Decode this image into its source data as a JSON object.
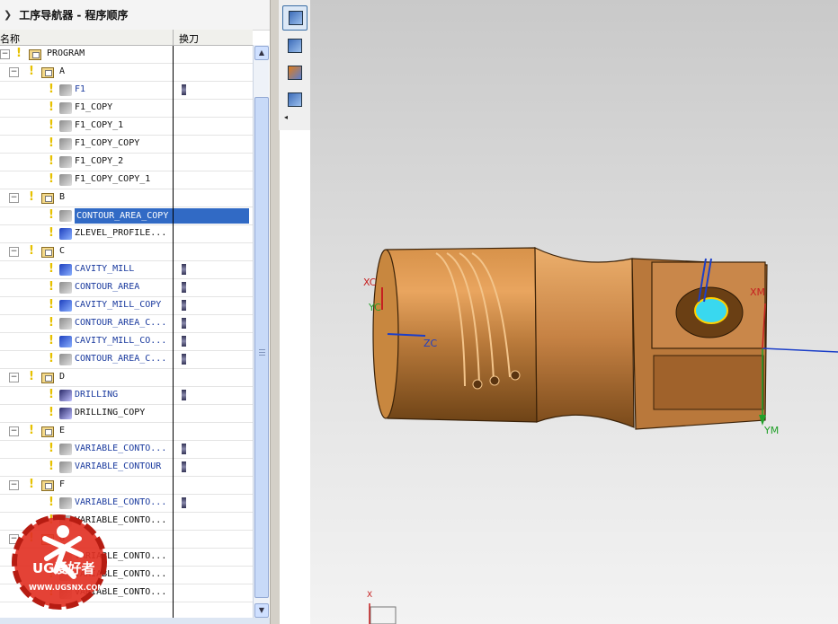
{
  "navigator": {
    "title": "工序导航器 - 程序顺序",
    "columns": {
      "name": "名称",
      "tool_change": "换刀"
    },
    "rows": [
      {
        "label": "PROGRAM",
        "level": 0,
        "kind": "root",
        "color": "black",
        "toggle": "−"
      },
      {
        "label": "A",
        "level": 1,
        "kind": "group",
        "color": "black",
        "toggle": "−"
      },
      {
        "label": "F1",
        "level": 2,
        "kind": "op",
        "color": "blue",
        "tool": true
      },
      {
        "label": "F1_COPY",
        "level": 2,
        "kind": "op",
        "color": "black"
      },
      {
        "label": "F1_COPY_1",
        "level": 2,
        "kind": "op",
        "color": "black"
      },
      {
        "label": "F1_COPY_COPY",
        "level": 2,
        "kind": "op",
        "color": "black"
      },
      {
        "label": "F1_COPY_2",
        "level": 2,
        "kind": "op",
        "color": "black"
      },
      {
        "label": "F1_COPY_COPY_1",
        "level": 2,
        "kind": "op",
        "color": "black"
      },
      {
        "label": "B",
        "level": 1,
        "kind": "group",
        "color": "black",
        "toggle": "−"
      },
      {
        "label": "CONTOUR_AREA_COPY",
        "level": 2,
        "kind": "op",
        "color": "blue",
        "selected": true
      },
      {
        "label": "ZLEVEL_PROFILE...",
        "level": 2,
        "kind": "op-blue",
        "color": "black"
      },
      {
        "label": "C",
        "level": 1,
        "kind": "group",
        "color": "black",
        "toggle": "−"
      },
      {
        "label": "CAVITY_MILL",
        "level": 2,
        "kind": "op-blue",
        "color": "blue",
        "tool": true
      },
      {
        "label": "CONTOUR_AREA",
        "level": 2,
        "kind": "op",
        "color": "blue",
        "tool": true
      },
      {
        "label": "CAVITY_MILL_COPY",
        "level": 2,
        "kind": "op-blue",
        "color": "blue",
        "tool": true
      },
      {
        "label": "CONTOUR_AREA_C...",
        "level": 2,
        "kind": "op",
        "color": "blue",
        "tool": true
      },
      {
        "label": "CAVITY_MILL_CO...",
        "level": 2,
        "kind": "op-blue",
        "color": "blue",
        "tool": true
      },
      {
        "label": "CONTOUR_AREA_C...",
        "level": 2,
        "kind": "op",
        "color": "blue",
        "tool": true
      },
      {
        "label": "D",
        "level": 1,
        "kind": "group",
        "color": "black",
        "toggle": "−"
      },
      {
        "label": "DRILLING",
        "level": 2,
        "kind": "op-drill",
        "color": "blue",
        "tool": true
      },
      {
        "label": "DRILLING_COPY",
        "level": 2,
        "kind": "op-drill",
        "color": "black"
      },
      {
        "label": "E",
        "level": 1,
        "kind": "group",
        "color": "black",
        "toggle": "−"
      },
      {
        "label": "VARIABLE_CONTO...",
        "level": 2,
        "kind": "op",
        "color": "blue",
        "tool": true
      },
      {
        "label": "VARIABLE_CONTOUR",
        "level": 2,
        "kind": "op",
        "color": "blue",
        "tool": true
      },
      {
        "label": "F",
        "level": 1,
        "kind": "group",
        "color": "black",
        "toggle": "−"
      },
      {
        "label": "VARIABLE_CONTO...",
        "level": 2,
        "kind": "op",
        "color": "blue",
        "tool": true
      },
      {
        "label": "VARIABLE_CONTO...",
        "level": 2,
        "kind": "op",
        "color": "black"
      },
      {
        "label": "G",
        "level": 1,
        "kind": "group",
        "color": "black",
        "toggle": "−"
      },
      {
        "label": "VARIABLE_CONTO...",
        "level": 2,
        "kind": "op",
        "color": "black"
      },
      {
        "label": "VARIABLE_CONTO...",
        "level": 2,
        "kind": "op",
        "color": "black"
      },
      {
        "label": "VARIABLE_CONTO...",
        "level": 2,
        "kind": "op",
        "color": "black"
      }
    ]
  },
  "toolbar": {
    "buttons": [
      {
        "name": "program-order-view-button",
        "icon": "program-order-icon",
        "active": true
      },
      {
        "name": "machine-tool-view-button",
        "icon": "machine-tool-icon",
        "active": false
      },
      {
        "name": "geometry-view-button",
        "icon": "geometry-view-icon",
        "active": false
      },
      {
        "name": "machining-method-view-button",
        "icon": "machining-method-icon",
        "active": false
      }
    ]
  },
  "viewport": {
    "axes": {
      "xc": "XC",
      "yc": "YC",
      "zc": "ZC",
      "xm": "XM",
      "ym": "YM",
      "x": "X"
    },
    "colors": {
      "part": "#b8793a",
      "tool_cyan": "#39d8ef",
      "axis_blue": "#1c3fc8",
      "axis_green": "#22a02a",
      "axis_red": "#c62020"
    }
  },
  "watermark": {
    "brand": "UG爱好者",
    "site": "WWW.UGSNX.COM"
  }
}
